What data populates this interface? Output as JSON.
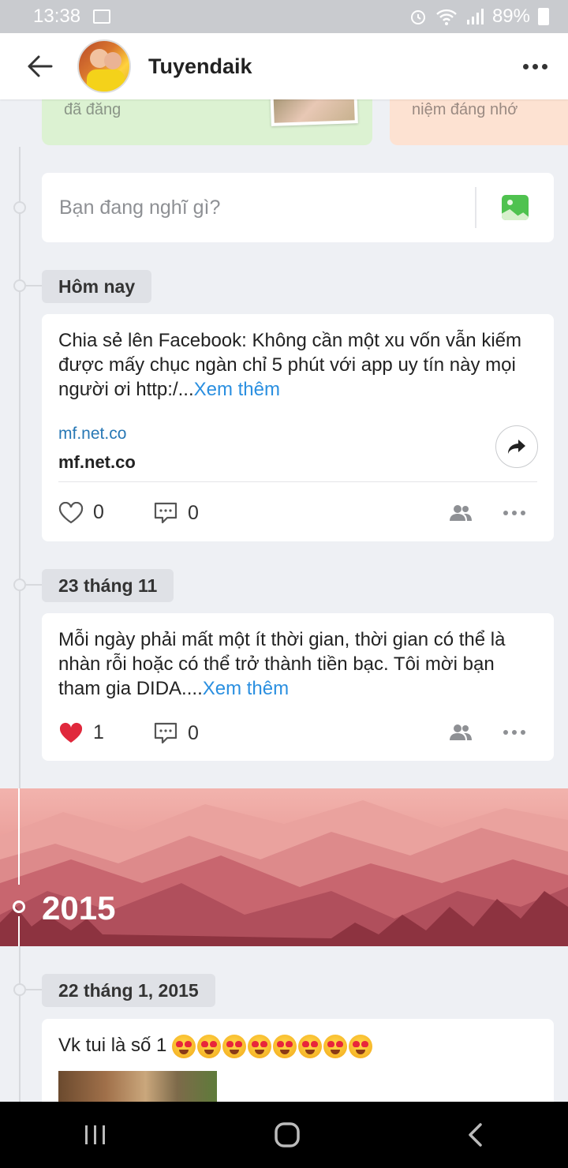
{
  "status_bar": {
    "time": "13:38",
    "battery": "89%"
  },
  "header": {
    "name": "Tuyendaik"
  },
  "top_cards": {
    "left_text": "đã đăng",
    "right_text": "niệm đáng nhớ"
  },
  "composer": {
    "placeholder": "Bạn đang nghĩ gì?"
  },
  "sections": [
    {
      "date": "Hôm nay",
      "post": {
        "text": "Chia sẻ lên Facebook: Không cần một xu vốn vẫn kiếm được mấy chục ngàn chỉ 5 phút với app uy tín này mọi người ơi http:/...",
        "more": "Xem thêm",
        "link_url": "mf.net.co",
        "link_title": "mf.net.co",
        "likes": "0",
        "comments": "0",
        "liked": false
      }
    },
    {
      "date": "23 tháng 11",
      "post": {
        "text": "Mỗi ngày phải mất một ít thời gian, thời gian có thể là nhàn rỗi hoặc có thể trở thành tiền bạc. Tôi mời bạn tham gia DIDA....",
        "more": "Xem thêm",
        "likes": "1",
        "comments": "0",
        "liked": true
      }
    }
  ],
  "year_banner": {
    "year": "2015"
  },
  "section_2015": {
    "date": "22 tháng 1, 2015",
    "post_text": "Vk tui là số 1",
    "emoji_count": 8
  },
  "icons": {
    "back": "arrow-left-icon",
    "more": "more-horizontal-icon",
    "image": "image-icon",
    "heart": "heart-icon",
    "comment": "comment-icon",
    "friends": "friends-icon",
    "share": "share-icon"
  },
  "colors": {
    "link": "#2a8fe0",
    "heart": "#e0283c",
    "banner": "#cf6e76"
  }
}
